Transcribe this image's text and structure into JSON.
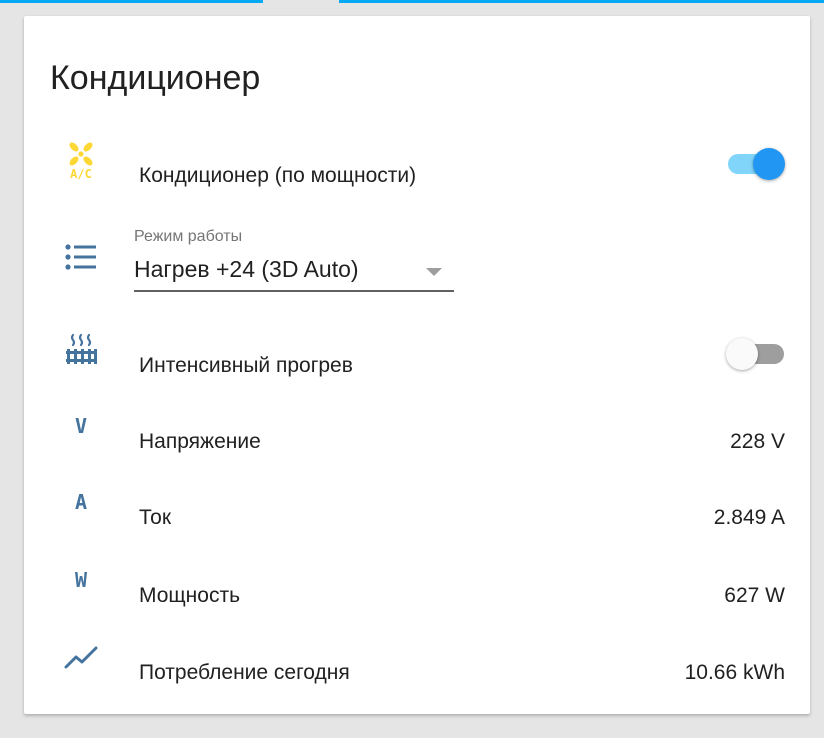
{
  "card": {
    "title": "Кондиционер"
  },
  "rows": {
    "ac_power": {
      "icon": "air-conditioner-icon",
      "icon_text": "A/C",
      "label": "Кондиционер (по мощности)",
      "state": "on"
    },
    "mode": {
      "icon": "format-list-bulleted-icon",
      "label": "Режим работы",
      "value": "Нагрев +24 (3D Auto)"
    },
    "intensive_heat": {
      "icon": "radiator-icon",
      "label": "Интенсивный прогрев",
      "state": "off"
    },
    "voltage": {
      "icon": "letter-v-icon",
      "icon_letter": "V",
      "label": "Напряжение",
      "value": "228 V"
    },
    "current": {
      "icon": "letter-a-icon",
      "icon_letter": "A",
      "label": "Ток",
      "value": "2.849 A"
    },
    "power": {
      "icon": "letter-w-icon",
      "icon_letter": "W",
      "label": "Мощность",
      "value": "627 W"
    },
    "energy_today": {
      "icon": "chart-line-icon",
      "label": "Потребление сегодня",
      "value": "10.66 kWh"
    }
  },
  "colors": {
    "accent": "#03a9f4",
    "toggle_on_thumb": "#2196f3",
    "toggle_on_track": "#81d4fa",
    "toggle_off_track": "#9e9e9e",
    "icon": "#44739e",
    "ac_icon": "#fdd835"
  }
}
